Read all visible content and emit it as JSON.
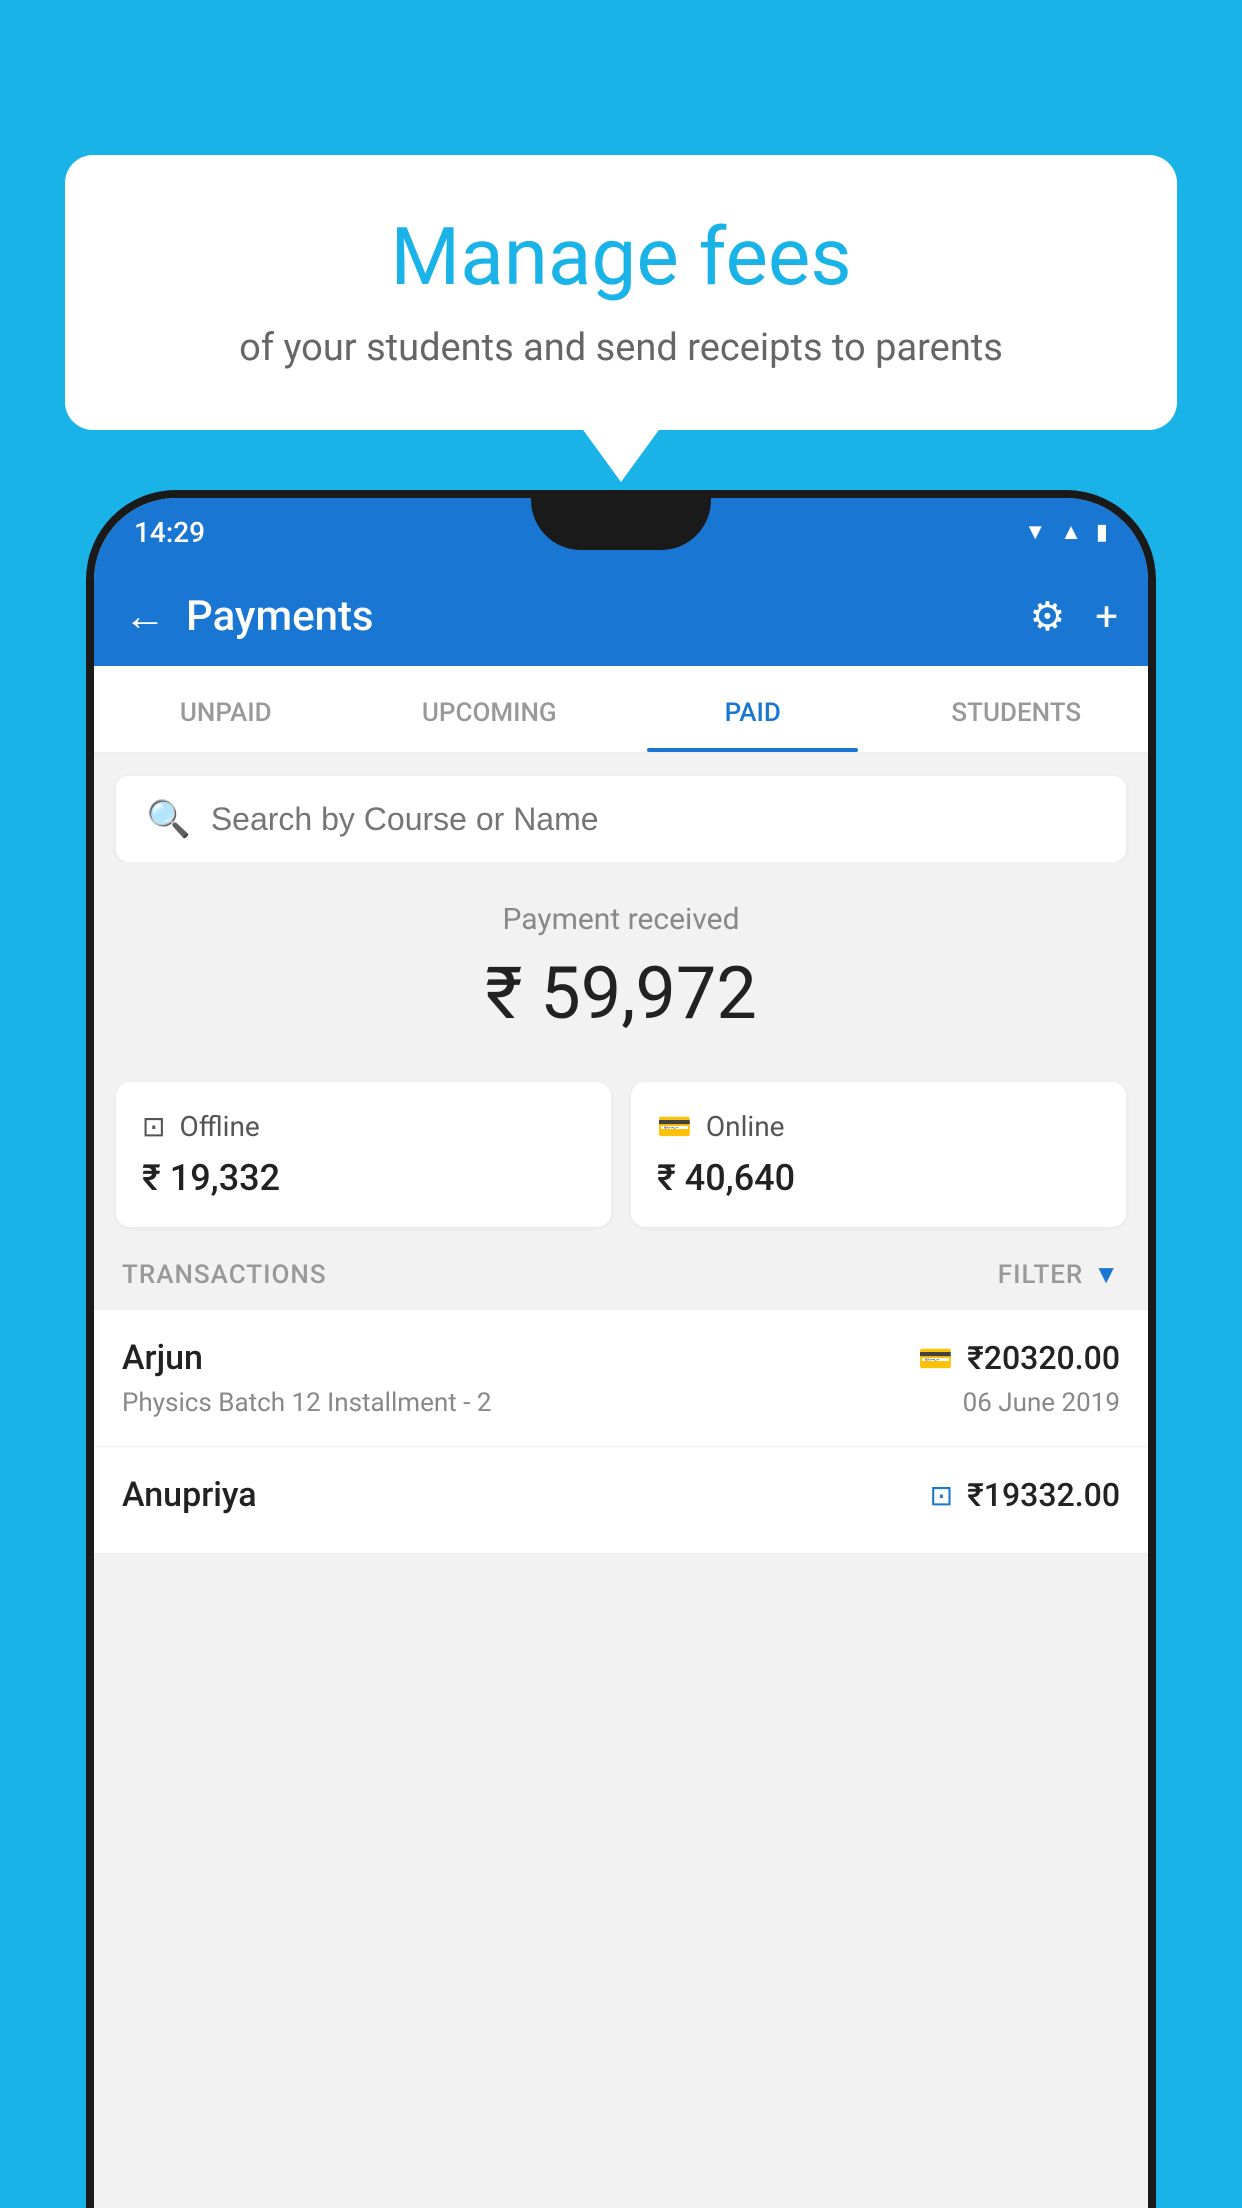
{
  "background_color": "#1ab3e8",
  "bubble": {
    "title": "Manage fees",
    "subtitle": "of your students and send receipts to parents"
  },
  "status_bar": {
    "time": "14:29",
    "icons": [
      "wifi",
      "signal",
      "battery"
    ]
  },
  "app_bar": {
    "title": "Payments",
    "back_label": "←",
    "settings_icon": "⚙",
    "add_icon": "+"
  },
  "tabs": [
    {
      "label": "UNPAID",
      "active": false
    },
    {
      "label": "UPCOMING",
      "active": false
    },
    {
      "label": "PAID",
      "active": true
    },
    {
      "label": "STUDENTS",
      "active": false
    }
  ],
  "search": {
    "placeholder": "Search by Course or Name"
  },
  "payment_received": {
    "label": "Payment received",
    "amount": "₹ 59,972"
  },
  "payment_cards": [
    {
      "type": "Offline",
      "icon": "offline",
      "amount": "₹ 19,332"
    },
    {
      "type": "Online",
      "icon": "online",
      "amount": "₹ 40,640"
    }
  ],
  "transactions_label": "TRANSACTIONS",
  "filter_label": "FILTER",
  "transactions": [
    {
      "name": "Arjun",
      "course": "Physics Batch 12 Installment - 2",
      "amount": "₹20320.00",
      "date": "06 June 2019",
      "payment_type": "online"
    },
    {
      "name": "Anupriya",
      "course": "",
      "amount": "₹19332.00",
      "date": "",
      "payment_type": "offline"
    }
  ]
}
